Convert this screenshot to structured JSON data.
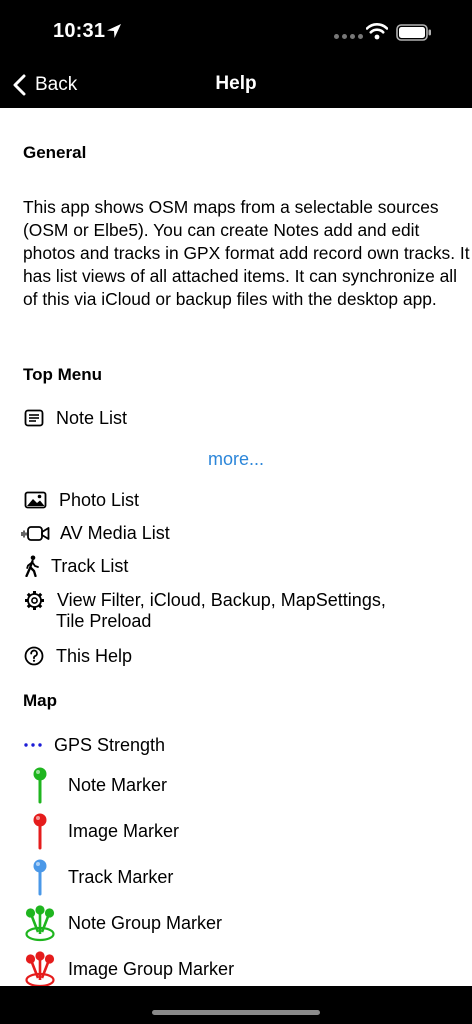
{
  "status_bar": {
    "time": "10:31"
  },
  "nav": {
    "back_label": "Back",
    "title": "Help"
  },
  "sections": {
    "general": {
      "title": "General",
      "text": "This app shows OSM maps from a selectable sources (OSM or Elbe5). You can create Notes add and edit photos and tracks in GPX format add record own tracks. It has list views of all attached items. It can synchronize all of this via iCloud or backup files with the desktop app."
    },
    "top_menu": {
      "title": "Top Menu",
      "note_list": "Note List",
      "more": "more...",
      "photo_list": "Photo List",
      "av_media_list": "AV Media List",
      "track_list": "Track List",
      "view_filter_line1": "View Filter, iCloud, Backup, MapSettings,",
      "view_filter_line2": "Tile Preload",
      "this_help": "This Help"
    },
    "map": {
      "title": "Map",
      "gps_strength": "GPS Strength",
      "note_marker": "Note Marker",
      "image_marker": "Image Marker",
      "track_marker": "Track Marker",
      "note_group_marker": "Note Group Marker",
      "image_group_marker": "Image Group Marker"
    }
  },
  "colors": {
    "note_marker": "#1fb51f",
    "image_marker": "#e51c1c",
    "track_marker": "#4a98e8",
    "link": "#2c86d9",
    "gps_dots": "#1c1cd6"
  }
}
